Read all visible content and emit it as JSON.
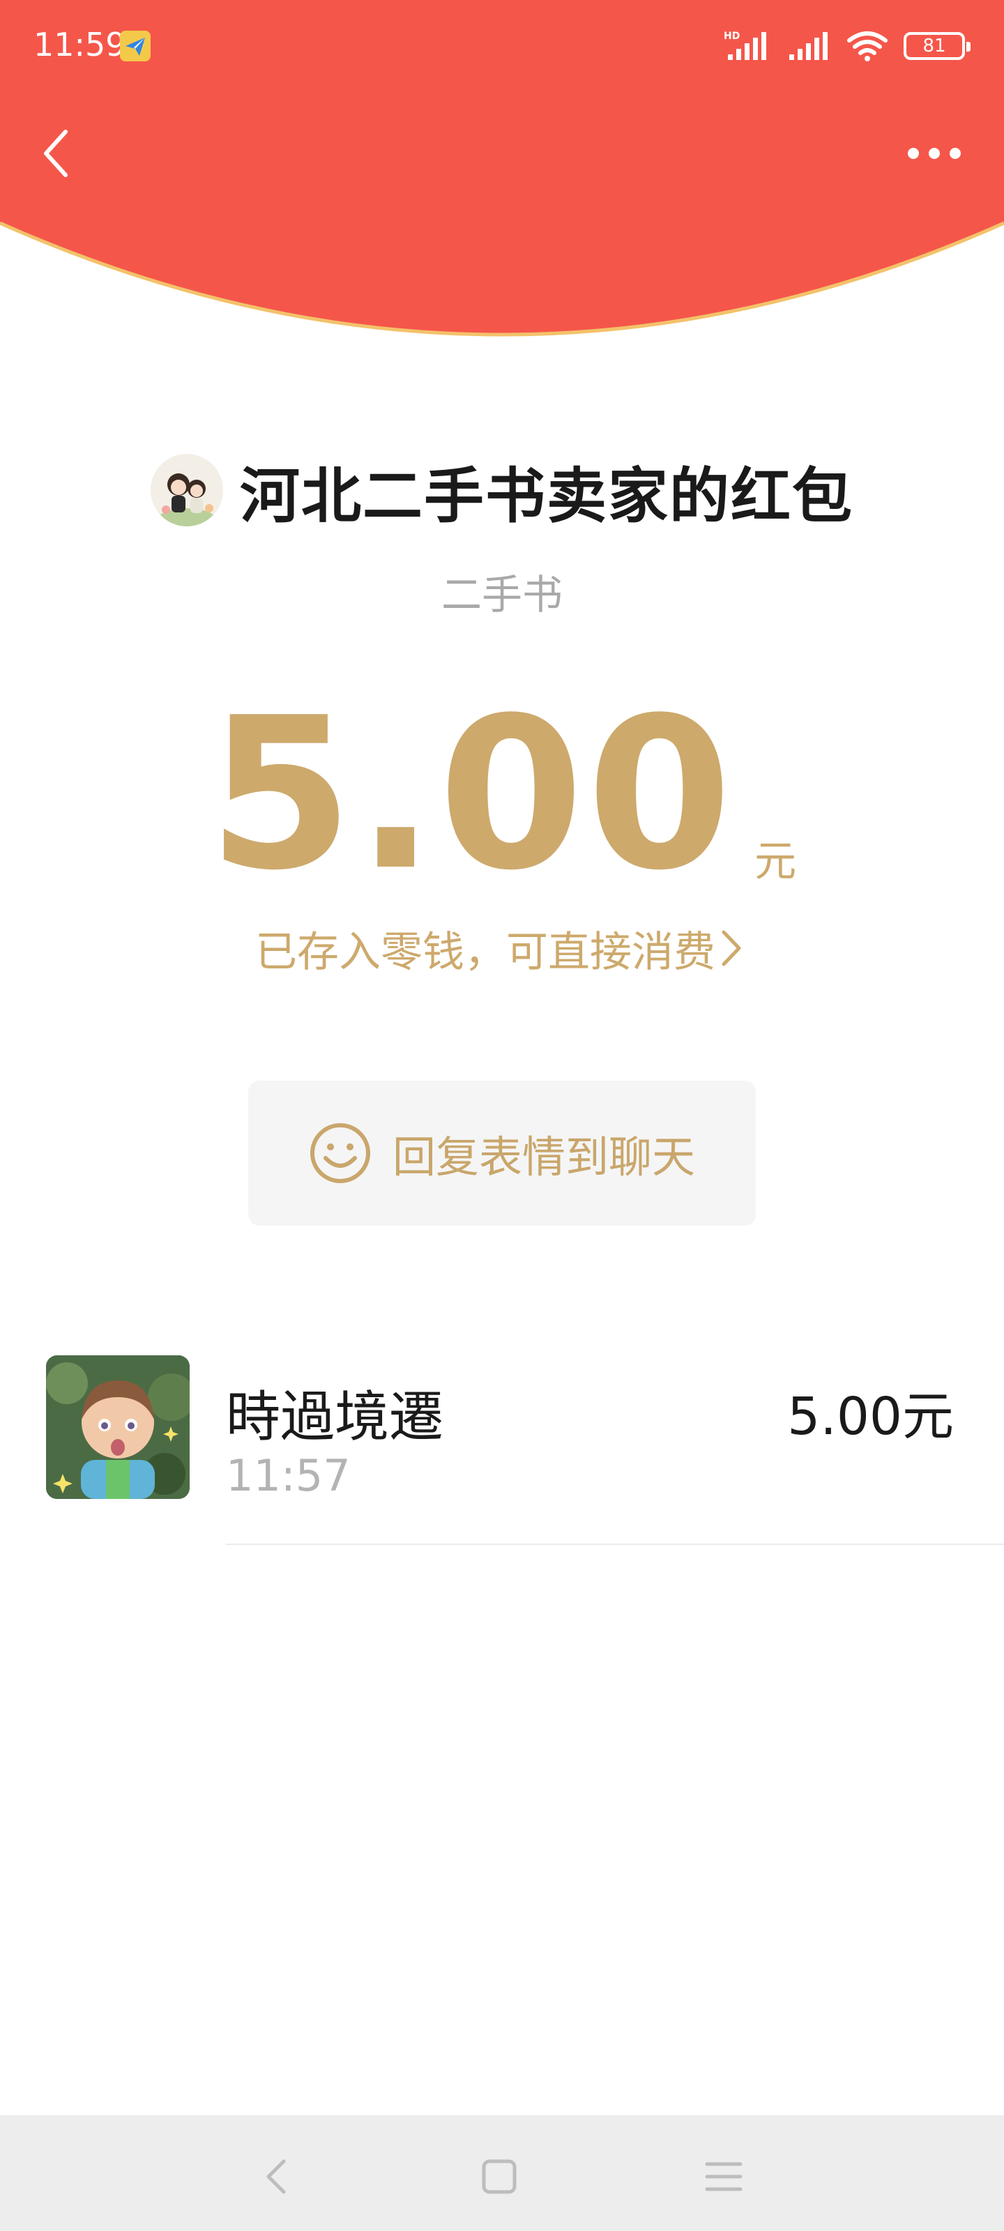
{
  "status_bar": {
    "time": "11:59",
    "network_label": "HD",
    "battery_level": "81"
  },
  "colors": {
    "header_red": "#f5564a",
    "gold": "#cda96c",
    "curve_edge": "#f3c26a"
  },
  "packet": {
    "sender_title": "河北二手书卖家的红包",
    "note": "二手书",
    "amount": "5.00",
    "unit": "元",
    "deposit_text": "已存入零钱，可直接消费"
  },
  "reply_button": {
    "label": "回复表情到聊天"
  },
  "receivers": [
    {
      "name": "時過境遷",
      "time": "11:57",
      "amount": "5.00元"
    }
  ],
  "icons": {
    "back": "chevron-left-icon",
    "more": "more-dots-icon",
    "reply": "smiley-icon",
    "deposit": "chevron-right-icon",
    "system_back": "system-back-icon",
    "system_home": "system-home-icon",
    "system_menu": "system-menu-icon"
  }
}
